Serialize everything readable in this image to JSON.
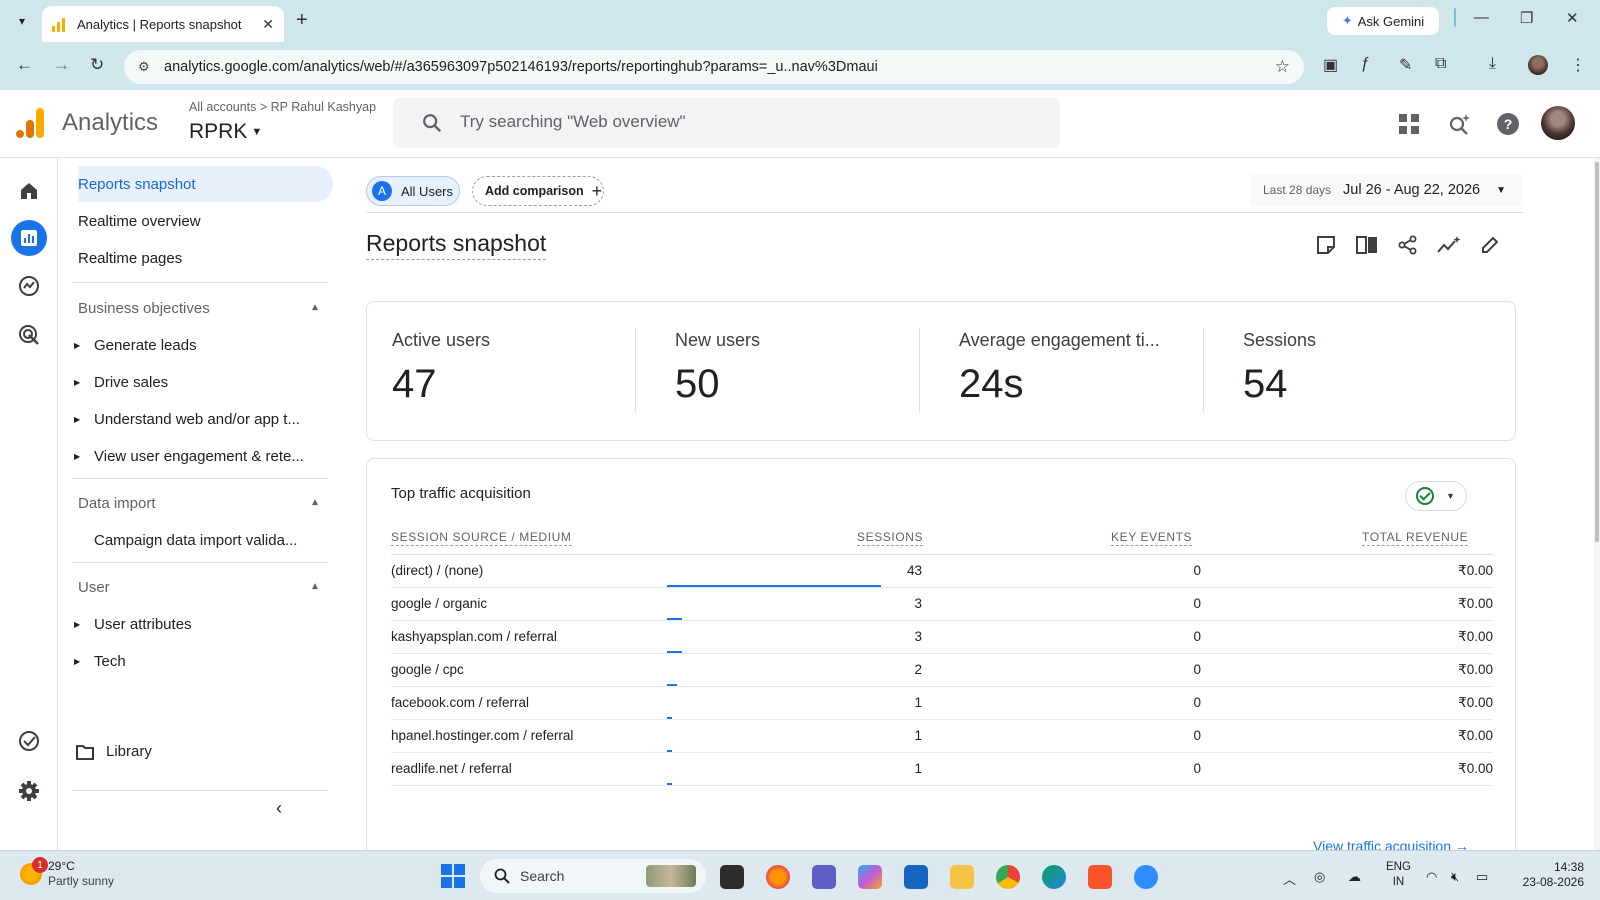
{
  "browser": {
    "tab_title": "Analytics | Reports snapshot",
    "close_glyph": "✕",
    "new_tab_glyph": "+",
    "ask_gemini": "Ask Gemini",
    "url": "analytics.google.com/analytics/web/#/a365963097p502146193/reports/reportinghub?params=_u..nav%3Dmaui"
  },
  "header": {
    "app_name": "Analytics",
    "breadcrumb": "All accounts > RP Rahul Kashyap",
    "property": "RPRK",
    "search_placeholder": "Try searching \"Web overview\""
  },
  "sidebar": {
    "items": [
      {
        "label": "Reports snapshot",
        "active": true
      },
      {
        "label": "Realtime overview"
      },
      {
        "label": "Realtime pages"
      }
    ],
    "sections": [
      {
        "title": "Business objectives",
        "children": [
          "Generate leads",
          "Drive sales",
          "Understand web and/or app t...",
          "View user engagement & rete..."
        ]
      },
      {
        "title": "Data import",
        "children": [
          "Campaign data import valida..."
        ]
      },
      {
        "title": "User",
        "children": [
          "User attributes",
          "Tech"
        ]
      }
    ],
    "library": "Library"
  },
  "main": {
    "segment_letter": "A",
    "segment": "All Users",
    "add_comparison": "Add comparison",
    "date_label": "Last 28 days",
    "date_range": "Jul 26 - Aug 22, 2026",
    "page_title": "Reports snapshot",
    "kpis": [
      {
        "label": "Active users",
        "value": "47"
      },
      {
        "label": "New users",
        "value": "50"
      },
      {
        "label": "Average engagement ti...",
        "value": "24s"
      },
      {
        "label": "Sessions",
        "value": "54"
      }
    ],
    "traffic": {
      "title": "Top traffic acquisition",
      "columns": [
        "SESSION SOURCE / MEDIUM",
        "SESSIONS",
        "KEY EVENTS",
        "TOTAL REVENUE"
      ],
      "rows": [
        {
          "source": "(direct) / (none)",
          "sessions": "43",
          "key_events": "0",
          "revenue": "₹0.00",
          "share": 1.0
        },
        {
          "source": "google / organic",
          "sessions": "3",
          "key_events": "0",
          "revenue": "₹0.00",
          "share": 0.07
        },
        {
          "source": "kashyapsplan.com / referral",
          "sessions": "3",
          "key_events": "0",
          "revenue": "₹0.00",
          "share": 0.07
        },
        {
          "source": "google / cpc",
          "sessions": "2",
          "key_events": "0",
          "revenue": "₹0.00",
          "share": 0.047
        },
        {
          "source": "facebook.com / referral",
          "sessions": "1",
          "key_events": "0",
          "revenue": "₹0.00",
          "share": 0.023
        },
        {
          "source": "hpanel.hostinger.com / referral",
          "sessions": "1",
          "key_events": "0",
          "revenue": "₹0.00",
          "share": 0.023
        },
        {
          "source": "readlife.net / referral",
          "sessions": "1",
          "key_events": "0",
          "revenue": "₹0.00",
          "share": 0.023
        }
      ],
      "view_link": "View traffic acquisition →"
    }
  },
  "taskbar": {
    "weather_badge": "1",
    "temperature": "29°C",
    "weather": "Partly sunny",
    "search": "Search",
    "lang1": "ENG",
    "lang2": "IN",
    "time": "14:38",
    "date": "23-08-2026"
  },
  "colors": {
    "accent": "#1a73e8",
    "active_bg": "#e8f0fe",
    "chrome_bg": "#cfe6ea",
    "logo_orange": "#e37400",
    "logo_yellow": "#f9ab00"
  }
}
